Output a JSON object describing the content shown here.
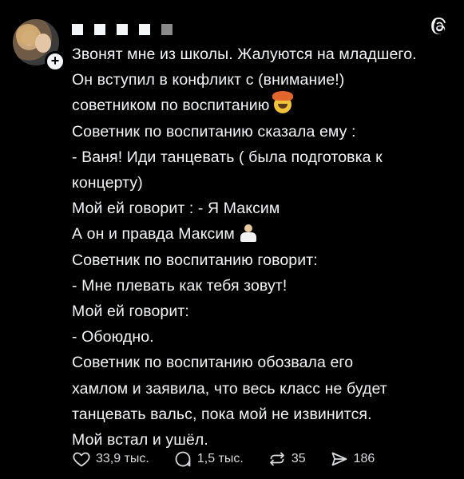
{
  "post": {
    "lines": [
      "Звонят мне из школы. Жалуются на младшего.",
      "Он вступил в конфликт с (внимание!)",
      "советником по воспитанию",
      "Советник по воспитанию сказала ему :",
      "- Ваня! Иди танцевать ( была подготовка к",
      "концерту)",
      "Мой ей говорит : - Я Максим",
      "А он и правда Максим",
      "Советник по воспитанию говорит:",
      "- Мне плевать как тебя зовут!",
      "Мой ей говорит:",
      "- Обоюдно.",
      "Советник по воспитанию обозвала его",
      "хамлом и заявила, что весь класс не будет",
      "танцевать вальс, пока мой не извинится.",
      "Мой встал и ушёл."
    ],
    "emojis": [
      "exploding-head-icon",
      "shrug-icon"
    ]
  },
  "actions": {
    "likes": "33,9 тыс.",
    "replies": "1,5 тыс.",
    "reposts": "35",
    "shares": "186"
  },
  "colors": {
    "background": "#000000",
    "text": "#f3f5f7",
    "muted": "#d8dadc"
  },
  "icons": {
    "app": "threads-logo-icon",
    "follow": "plus-icon",
    "like": "heart-icon",
    "reply": "comment-icon",
    "repost": "repost-icon",
    "share": "send-icon"
  }
}
